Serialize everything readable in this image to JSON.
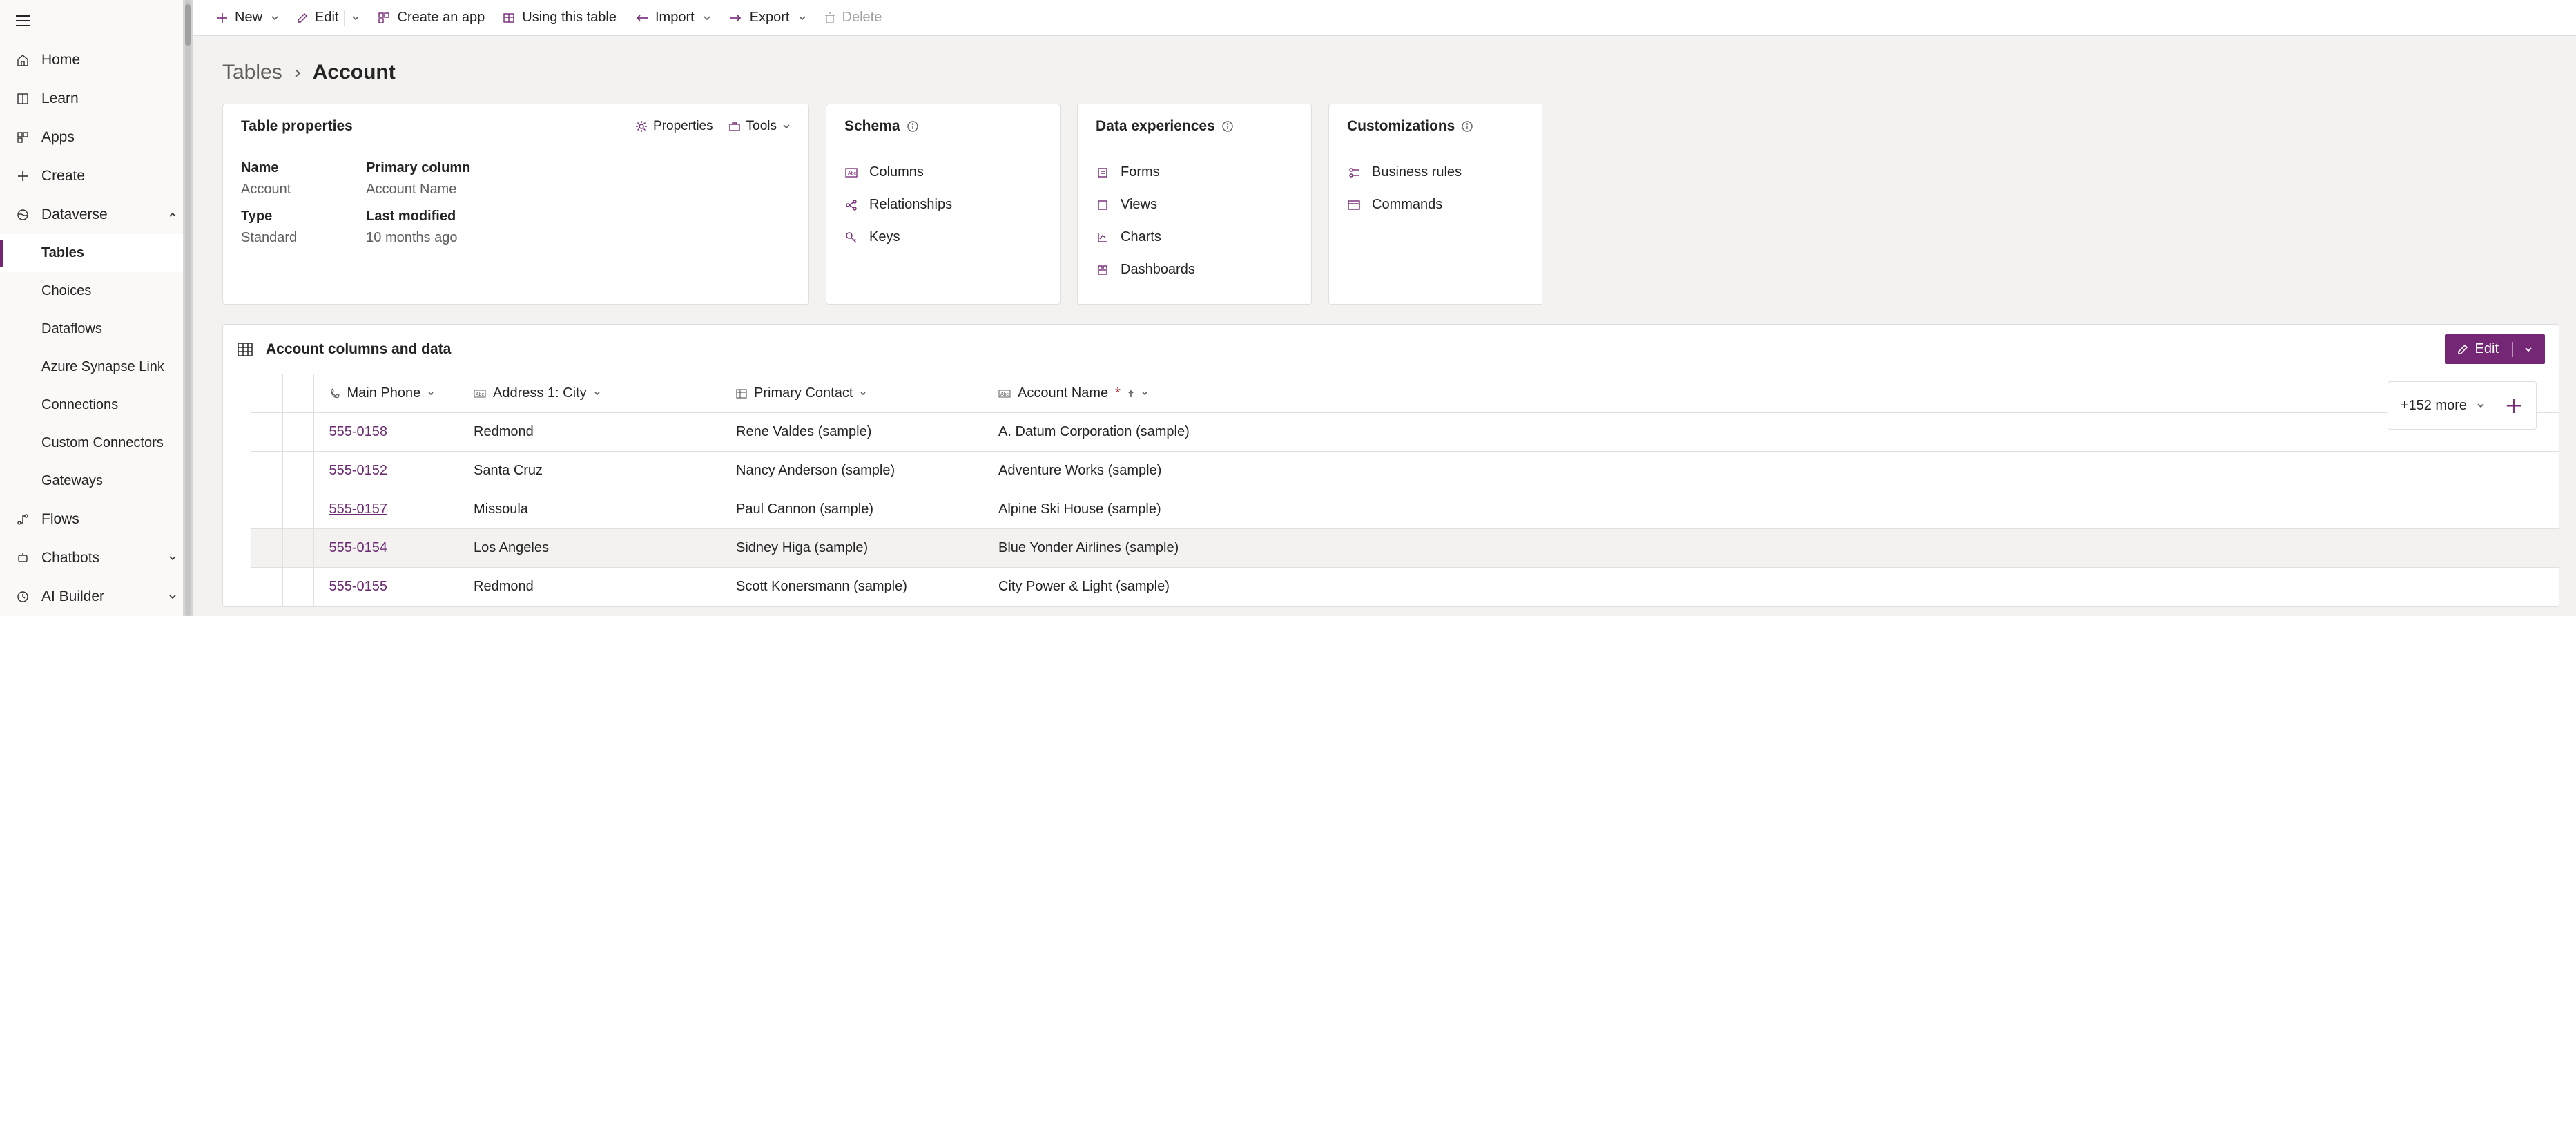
{
  "sidebar": {
    "items": [
      "Home",
      "Learn",
      "Apps",
      "Create",
      "Dataverse",
      "Tables",
      "Choices",
      "Dataflows",
      "Azure Synapse Link",
      "Connections",
      "Custom Connectors",
      "Gateways",
      "Flows",
      "Chatbots",
      "AI Builder"
    ]
  },
  "cmdbar": {
    "new": "New",
    "edit": "Edit",
    "create_app": "Create an app",
    "using_table": "Using this table",
    "import": "Import",
    "export": "Export",
    "delete": "Delete"
  },
  "breadcrumb": {
    "root": "Tables",
    "current": "Account"
  },
  "cards": {
    "properties": {
      "title": "Table properties",
      "actions": {
        "properties": "Properties",
        "tools": "Tools"
      },
      "rows": {
        "name_k": "Name",
        "name_v": "Account",
        "type_k": "Type",
        "type_v": "Standard",
        "pcol_k": "Primary column",
        "pcol_v": "Account Name",
        "mod_k": "Last modified",
        "mod_v": "10 months ago"
      }
    },
    "schema": {
      "title": "Schema",
      "items": [
        "Columns",
        "Relationships",
        "Keys"
      ]
    },
    "data_exp": {
      "title": "Data experiences",
      "items": [
        "Forms",
        "Views",
        "Charts",
        "Dashboards"
      ]
    },
    "custom": {
      "title": "Customizations",
      "items": [
        "Business rules",
        "Commands"
      ]
    }
  },
  "grid": {
    "title": "Account columns and data",
    "edit": "Edit",
    "more": "+152 more",
    "columns": [
      "Main Phone",
      "Address 1: City",
      "Primary Contact",
      "Account Name"
    ],
    "pk_indicator": "*",
    "rows": [
      {
        "phone": "555-0158",
        "city": "Redmond",
        "contact": "Rene Valdes (sample)",
        "name": "A. Datum Corporation (sample)"
      },
      {
        "phone": "555-0152",
        "city": "Santa Cruz",
        "contact": "Nancy Anderson (sample)",
        "name": "Adventure Works (sample)"
      },
      {
        "phone": "555-0157",
        "city": "Missoula",
        "contact": "Paul Cannon (sample)",
        "name": "Alpine Ski House (sample)",
        "underline": true
      },
      {
        "phone": "555-0154",
        "city": "Los Angeles",
        "contact": "Sidney Higa (sample)",
        "name": "Blue Yonder Airlines (sample)",
        "hover": true
      },
      {
        "phone": "555-0155",
        "city": "Redmond",
        "contact": "Scott Konersmann (sample)",
        "name": "City Power & Light (sample)"
      }
    ]
  }
}
